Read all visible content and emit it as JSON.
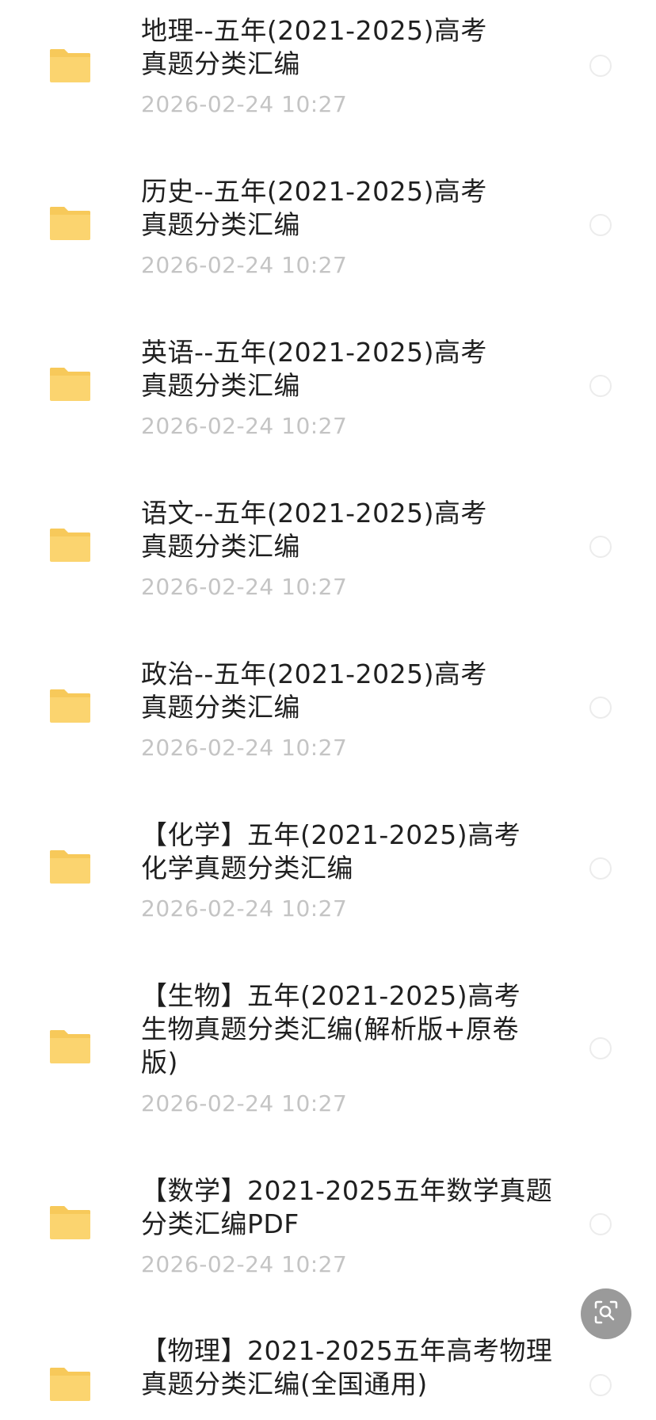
{
  "files": [
    {
      "name_line1": "地理--五年(2021-2025)高考",
      "name_line2": "真题分类汇编",
      "name_line3": "",
      "date": "2026-02-24 10:27",
      "icon": "folder-icon"
    },
    {
      "name_line1": "历史--五年(2021-2025)高考",
      "name_line2": "真题分类汇编",
      "name_line3": "",
      "date": "2026-02-24 10:27",
      "icon": "folder-icon"
    },
    {
      "name_line1": "英语--五年(2021-2025)高考",
      "name_line2": "真题分类汇编",
      "name_line3": "",
      "date": "2026-02-24 10:27",
      "icon": "folder-icon"
    },
    {
      "name_line1": "语文--五年(2021-2025)高考",
      "name_line2": "真题分类汇编",
      "name_line3": "",
      "date": "2026-02-24 10:27",
      "icon": "folder-icon"
    },
    {
      "name_line1": "政治--五年(2021-2025)高考",
      "name_line2": "真题分类汇编",
      "name_line3": "",
      "date": "2026-02-24 10:27",
      "icon": "folder-icon"
    },
    {
      "name_line1": "【化学】五年(2021-2025)高考",
      "name_line2": "化学真题分类汇编",
      "name_line3": "",
      "date": "2026-02-24 10:27",
      "icon": "folder-icon"
    },
    {
      "name_line1": "【生物】五年(2021-2025)高考",
      "name_line2": "生物真题分类汇编(解析版+原卷",
      "name_line3": "版)",
      "date": "2026-02-24 10:27",
      "icon": "folder-icon"
    },
    {
      "name_line1": "【数学】2021-2025五年数学真题",
      "name_line2": "分类汇编PDF",
      "name_line3": "",
      "date": "2026-02-24 10:27",
      "icon": "folder-icon"
    },
    {
      "name_line1": "【物理】2021-2025五年高考物理",
      "name_line2": "真题分类汇编(全国通用)",
      "name_line3": "",
      "date": "",
      "icon": "folder-icon"
    }
  ],
  "colors": {
    "folder": "#fbd46f",
    "folder_tab": "#f7c95a",
    "title_text": "#1f1f1f",
    "date_text": "#c4c4c4",
    "circle_border": "#ececec",
    "lens_button": "#9a9a9a"
  },
  "floating_button": {
    "icon": "lens-search-icon"
  }
}
